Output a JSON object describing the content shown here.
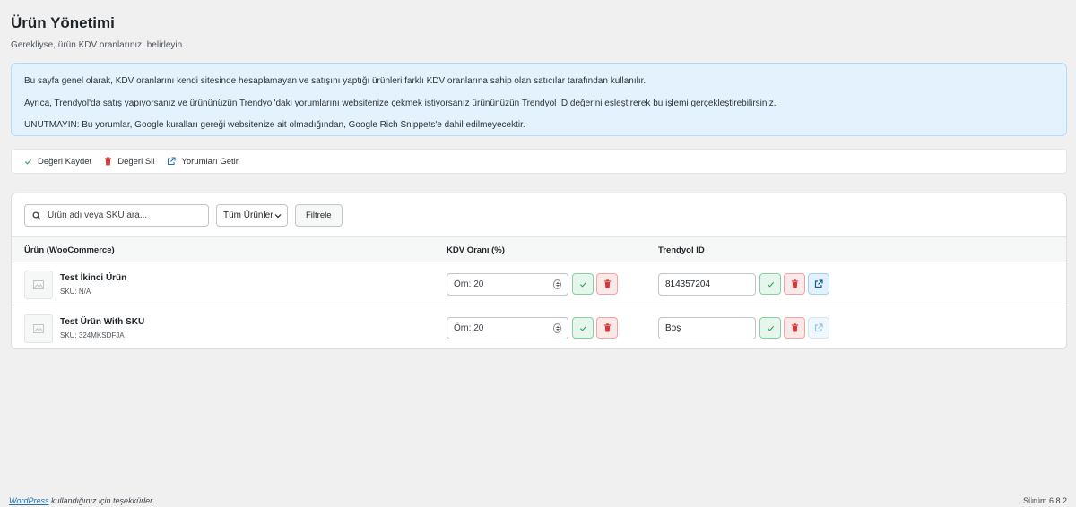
{
  "header": {
    "title": "Ürün Yönetimi",
    "subtitle": "Gerekliyse, ürün KDV oranlarınızı belirleyin.."
  },
  "info": {
    "line1": "Bu sayfa genel olarak, KDV oranlarını kendi sitesinde hesaplamayan ve satışını yaptığı ürünleri farklı KDV oranlarına sahip olan satıcılar tarafından kullanılır.",
    "line2": "Ayrıca, Trendyol'da satış yapıyorsanız ve ürününüzün Trendyol'daki yorumlarını websitenize çekmek istiyorsanız ürününüzün Trendyol ID değerini eşleştirerek bu işlemi gerçekleştirebilirsiniz.",
    "line3": "UNUTMAYIN: Bu yorumlar, Google kuralları gereği websitenize ait olmadığından, Google Rich Snippets'e dahil edilmeyecektir."
  },
  "legend": {
    "save": "Değeri Kaydet",
    "delete": "Değeri Sil",
    "reviews": "Yorumları Getir"
  },
  "filters": {
    "search_placeholder": "Ürün adı veya SKU ara...",
    "select_value": "Tüm Ürünler",
    "filter_button": "Filtrele"
  },
  "table": {
    "columns": {
      "product": "Ürün (WooCommerce)",
      "kdv": "KDV Oranı (%)",
      "trendyol": "Trendyol ID"
    },
    "rows": [
      {
        "name": "Test İkinci Ürün",
        "sku": "SKU: N/A",
        "kdv_placeholder": "Örn: 20",
        "trendyol_id": "814357204",
        "trendyol_placeholder": ""
      },
      {
        "name": "Test Ürün With SKU",
        "sku": "SKU: 324MKSDFJA",
        "kdv_placeholder": "Örn: 20",
        "trendyol_id": "",
        "trendyol_placeholder": "Boş"
      }
    ]
  },
  "footer": {
    "link": "WordPress",
    "thanks": " kullandığınız için teşekkürler.",
    "version": "Sürüm 6.8.2"
  },
  "colors": {
    "save_green": "#2fa85a",
    "delete_red": "#d63638",
    "link_blue": "#2271b1"
  }
}
